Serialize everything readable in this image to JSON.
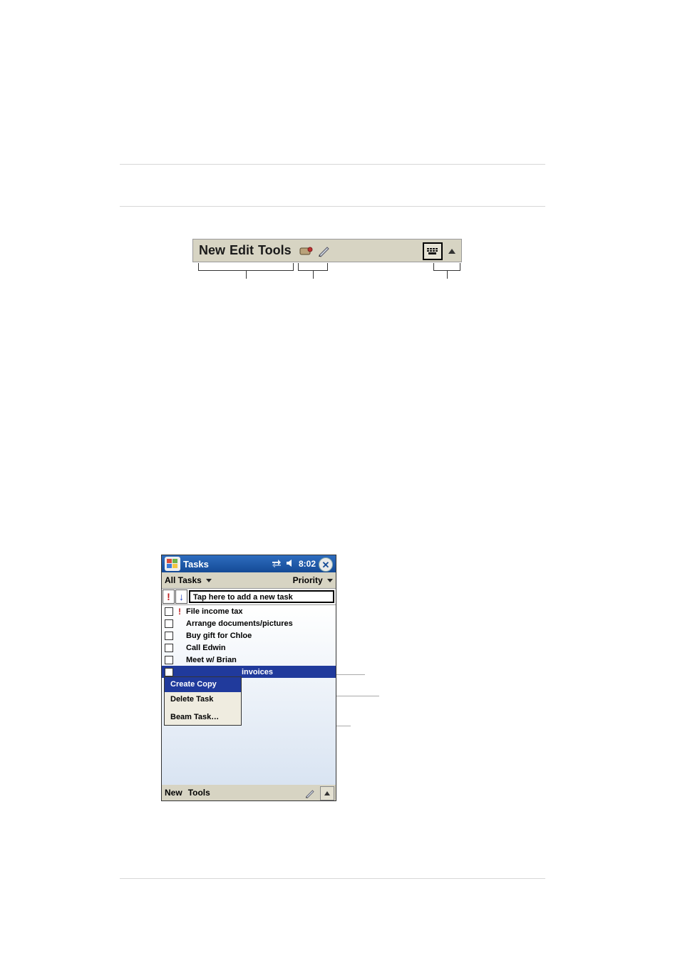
{
  "toolbar": {
    "items": [
      "New",
      "Edit",
      "Tools"
    ],
    "icons": [
      "voice-record-icon",
      "stylus-icon",
      "keyboard-icon",
      "arrow-up-icon"
    ]
  },
  "pda": {
    "title": "Tasks",
    "time": "8:02",
    "filter_left": "All Tasks",
    "filter_right": "Priority",
    "quick_add_placeholder": "Tap here to add a new task",
    "tasks": [
      {
        "priority": "high",
        "text": "File income tax"
      },
      {
        "priority": "",
        "text": "Arrange documents/pictures"
      },
      {
        "priority": "",
        "text": "Buy gift for Chloe"
      },
      {
        "priority": "",
        "text": "Call Edwin"
      },
      {
        "priority": "",
        "text": "Meet w/ Brian"
      }
    ],
    "selected_task_partial": "invoices",
    "context_menu": {
      "items": [
        "Create Copy",
        "Delete Task",
        "Beam Task…"
      ],
      "highlighted_index": 0
    },
    "bottom": {
      "new": "New",
      "tools": "Tools"
    }
  }
}
